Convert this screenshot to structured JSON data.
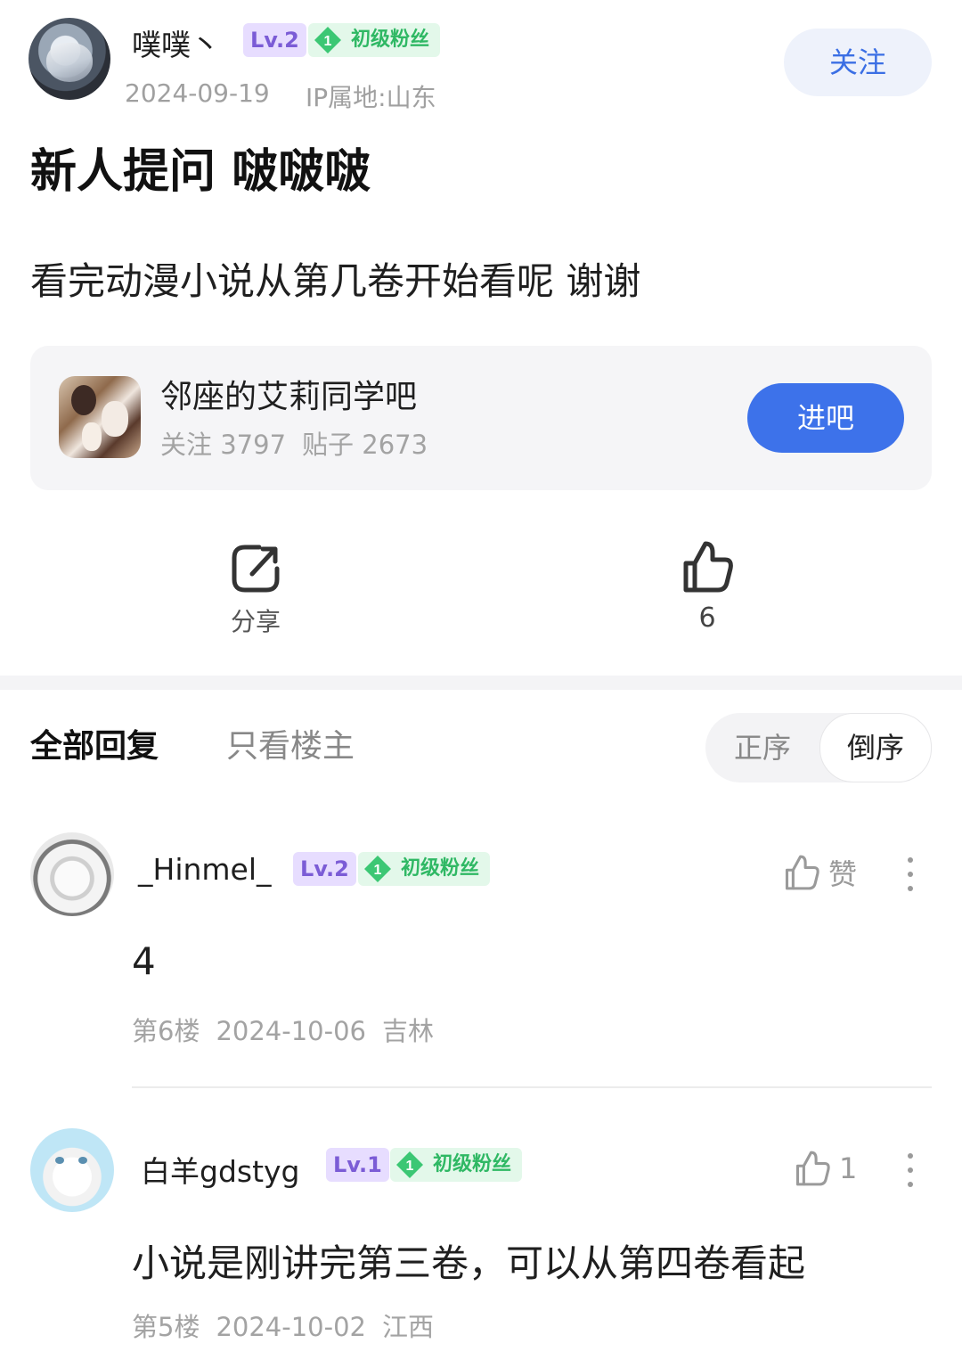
{
  "post": {
    "author": {
      "name": "噗噗丶",
      "level": "Lv.2",
      "fan_gem": "1",
      "fan_label": "初级粉丝",
      "date": "2024-09-19",
      "ip": "IP属地:山东"
    },
    "follow_label": "关注",
    "title": "新人提问 啵啵啵",
    "body": "看完动漫小说从第几卷开始看呢 谢谢"
  },
  "forum": {
    "name": "邻座的艾莉同学吧",
    "followers": "关注 3797",
    "posts": "贴子 2673",
    "enter_label": "进吧"
  },
  "actions": {
    "share_label": "分享",
    "like_count": "6"
  },
  "replies_header": {
    "tab_all": "全部回复",
    "tab_op_only": "只看楼主",
    "sort_asc": "正序",
    "sort_desc": "倒序"
  },
  "replies": [
    {
      "name": "_Hinmel_",
      "level": "Lv.2",
      "fan_gem": "1",
      "fan_label": "初级粉丝",
      "like_label": "赞",
      "content": "4",
      "floor": "第6楼",
      "date": "2024-10-06",
      "location": "吉林"
    },
    {
      "name": "白羊gdstyg",
      "level": "Lv.1",
      "fan_gem": "1",
      "fan_label": "初级粉丝",
      "like_count": "1",
      "content": "小说是刚讲完第三卷，可以从第四卷看起",
      "floor": "第5楼",
      "date": "2024-10-02",
      "location": "江西"
    }
  ],
  "colors": {
    "accent_blue": "#3d72ea",
    "level_purple": "#7b5cd6",
    "fan_green": "#2fb864",
    "muted_gray": "#a3a3a3"
  },
  "icons": [
    "share-icon",
    "thumbs-up-icon",
    "gem-icon",
    "more-vertical-icon"
  ]
}
